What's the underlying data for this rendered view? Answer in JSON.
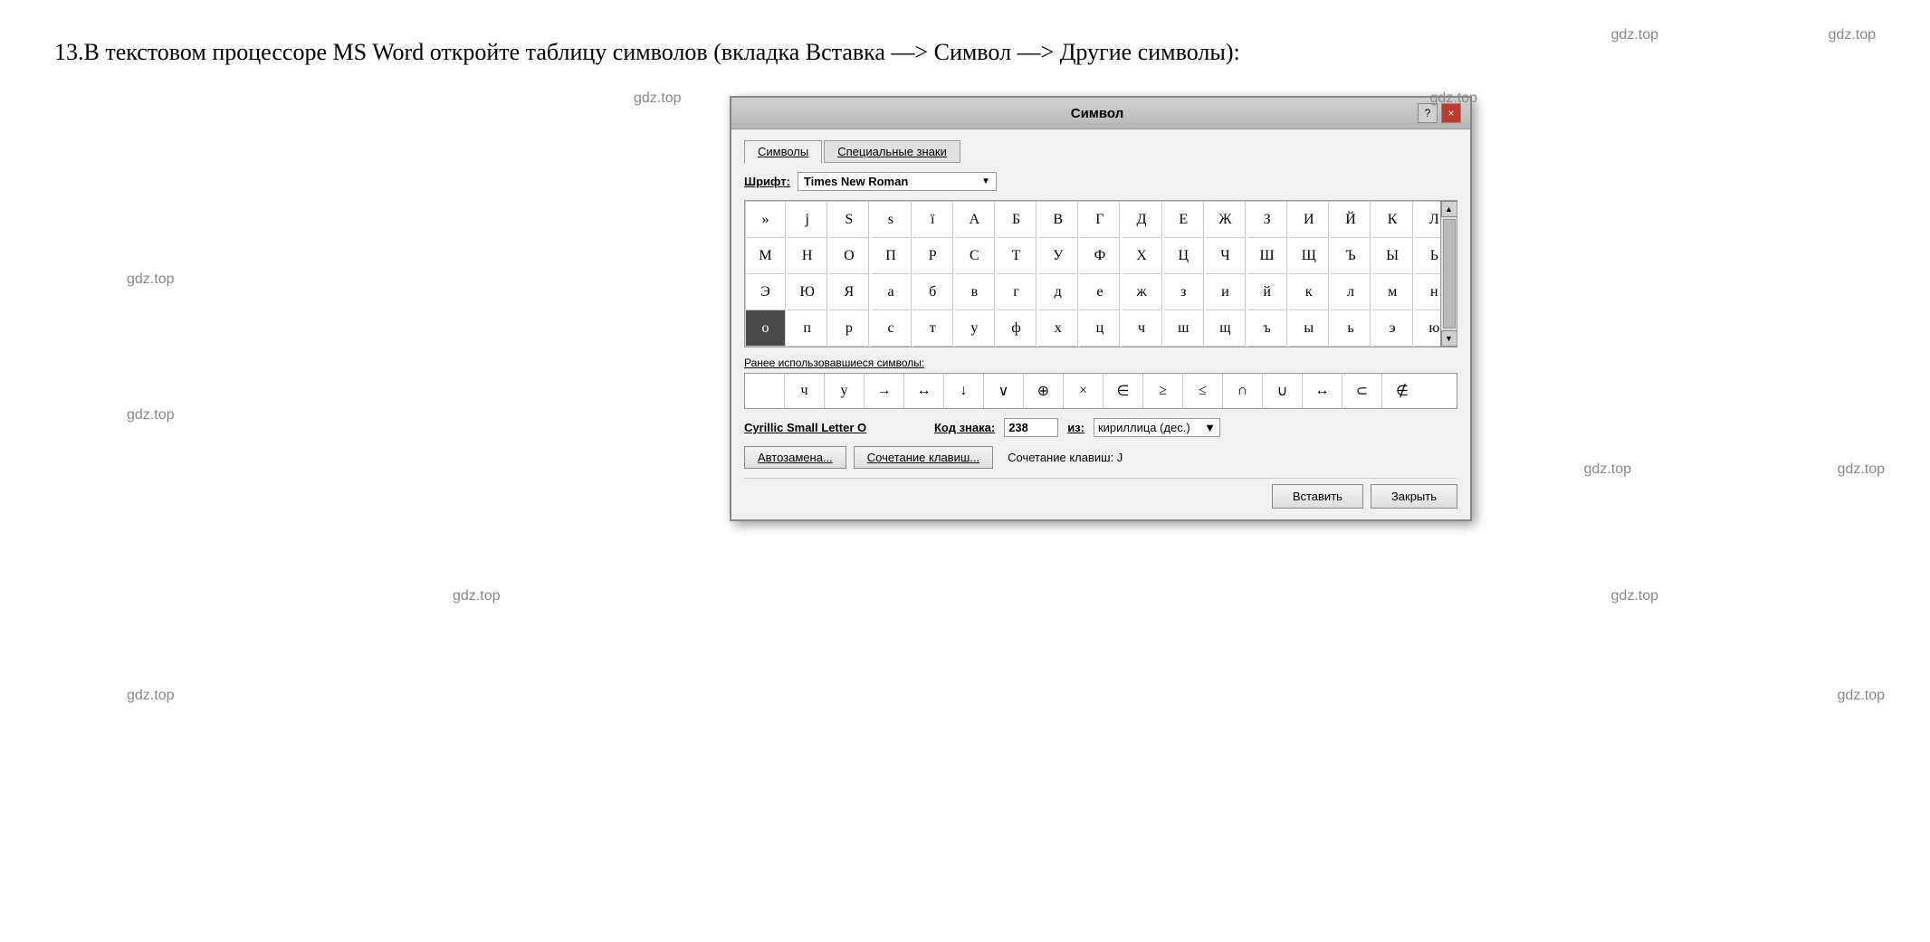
{
  "page": {
    "instruction": "13.В текстовом процессоре MS Word откройте таблицу символов (вкладка Вставка —> Символ —> Другие символы):",
    "watermark": "gdz.top"
  },
  "dialog": {
    "title": "Символ",
    "help_btn": "?",
    "close_btn": "×",
    "tabs": [
      {
        "label": "Символы",
        "active": true
      },
      {
        "label": "Специальные знаки",
        "active": false
      }
    ],
    "font_label": "Шрифт:",
    "font_value": "Times New Roman",
    "symbol_rows": [
      [
        "»",
        "j",
        "S",
        "s",
        "ï",
        "А",
        "Б",
        "В",
        "Г",
        "Д",
        "Е",
        "Ж",
        "З",
        "И",
        "Й",
        "К",
        "Л"
      ],
      [
        "М",
        "Н",
        "О",
        "П",
        "Р",
        "С",
        "Т",
        "У",
        "Ф",
        "Х",
        "Ц",
        "Ч",
        "Ш",
        "Щ",
        "Ъ",
        "Ы",
        "Ь"
      ],
      [
        "Э",
        "Ю",
        "Я",
        "а",
        "б",
        "в",
        "г",
        "д",
        "е",
        "ж",
        "з",
        "и",
        "й",
        "к",
        "л",
        "м",
        "н"
      ],
      [
        "о",
        "п",
        "р",
        "с",
        "т",
        "у",
        "ф",
        "х",
        "ц",
        "ч",
        "ш",
        "щ",
        "ъ",
        "ы",
        "ь",
        "э",
        "ю"
      ]
    ],
    "selected_cell": {
      "row": 3,
      "col": 0,
      "char": "о"
    },
    "recent_label": "Ранее использовавшиеся символы:",
    "recent_symbols": [
      "",
      "ч",
      "у",
      "→",
      "↔",
      "↓",
      "∨",
      "⊕",
      "×",
      "∈",
      "≥",
      "≤",
      "∩",
      "∪",
      "↔",
      "⊂",
      "∉"
    ],
    "char_name": "Cyrillic Small Letter O",
    "char_name_underlined": true,
    "code_label": "Код знака:",
    "code_value": "238",
    "from_label": "из:",
    "from_value": "кириллица (дес.)",
    "autoreplace_btn": "Автозамена...",
    "shortcut_btn": "Сочетание клавиш...",
    "shortcut_text": "Сочетание клавиш: J",
    "insert_btn": "Вставить",
    "close_dialog_btn": "Закрыть"
  }
}
